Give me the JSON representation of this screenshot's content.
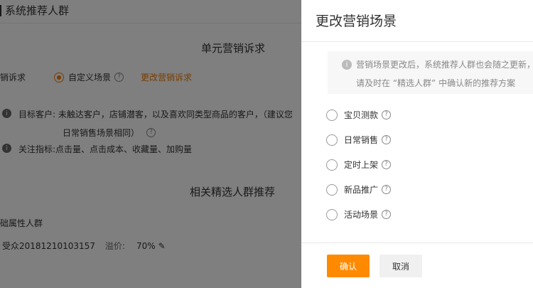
{
  "background": {
    "top_title": "系统推荐人群",
    "section1_title": "单元营销诉求",
    "appeal_label": "销诉求",
    "custom_scene_label": "自定义场景",
    "change_link": "更改营销诉求",
    "target_label": "目标客户:",
    "target_text_l1": "未触达客户，店铺潜客，以及喜欢同类型商品的客户，（建议您",
    "target_text_l2": "日常销售场景相同）",
    "metric_label": "关注指标:",
    "metric_text": "点击量、点击成本、收藏量、加购量",
    "section2_title": "相关精选人群推荐",
    "attr_label": "础属性人群",
    "audience_name": "受众20181210103157",
    "premium_label": "溢价:",
    "premium_value": "70%"
  },
  "drawer": {
    "title": "更改营销场景",
    "notice_line1": "营销场景更改后，系统推荐人群也会随之更新，",
    "notice_line2": "请及时在 “精选人群” 中确认新的推荐方案",
    "options": [
      {
        "label": "宝贝测款"
      },
      {
        "label": "日常销售"
      },
      {
        "label": "定时上架"
      },
      {
        "label": "新品推广"
      },
      {
        "label": "活动场景"
      }
    ],
    "confirm_label": "确认",
    "cancel_label": "取消"
  }
}
